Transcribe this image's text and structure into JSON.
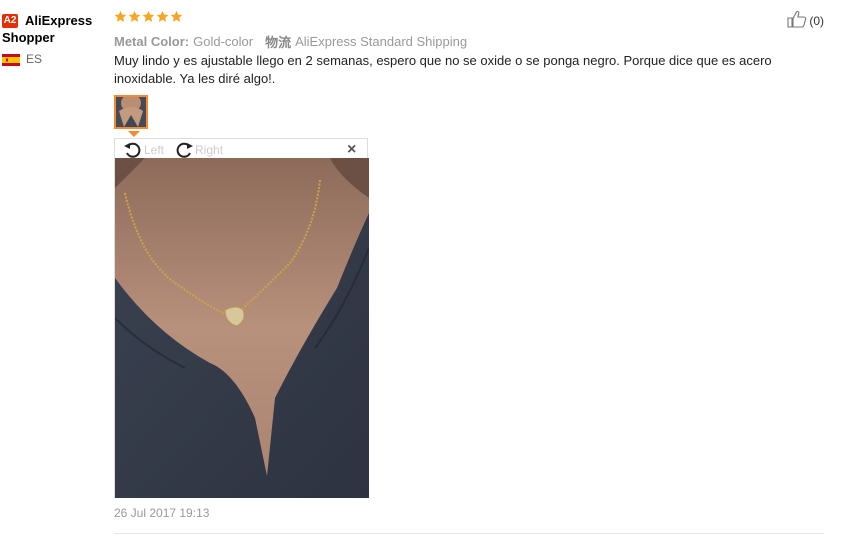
{
  "reviewer": {
    "level_badge": "A2",
    "name_line1": "AliExpress",
    "name_line2": "Shopper",
    "country_code": "ES",
    "flag_colors": {
      "red": "#c60b1e",
      "yellow": "#ffc400"
    }
  },
  "rating": {
    "stars": 5,
    "max": 5,
    "color": "#f5a623"
  },
  "helpful": {
    "count_label": "(0)",
    "icon": "thumbs-up-icon"
  },
  "attributes": {
    "color_label": "Metal Color:",
    "color_value": "Gold-color",
    "logistics_icon_label": "物流",
    "logistics_value": "AliExpress Standard Shipping"
  },
  "review": {
    "text": "Muy lindo y es ajustable llego en 2 semanas, espero que no se oxide o se ponga negro. Porque dice que es acero inoxidable. Ya les diré algo!."
  },
  "image_viewer": {
    "rotate_left_label": "Left",
    "rotate_right_label": "Right",
    "close_label": "×"
  },
  "date": "26 Jul 2017 19:13",
  "accent_color": "#f58a32"
}
